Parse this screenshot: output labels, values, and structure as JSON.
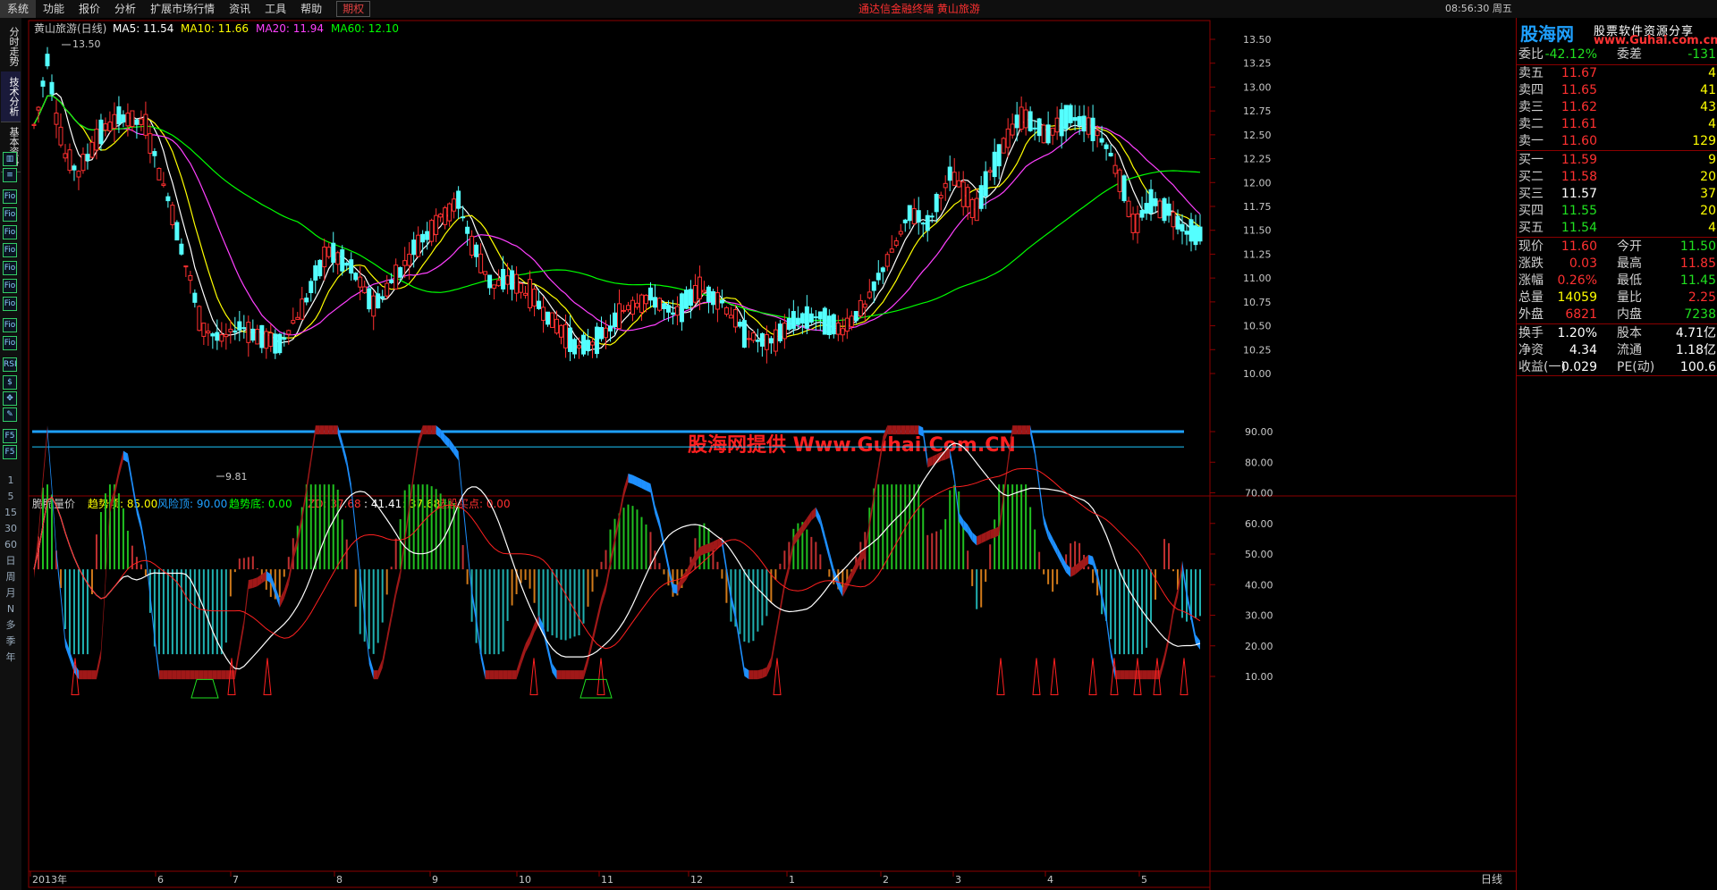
{
  "menu": {
    "items": [
      "系统",
      "功能",
      "报价",
      "分析",
      "扩展市场行情",
      "资讯",
      "工具",
      "帮助"
    ],
    "rights_tab": "期权",
    "center_title": "通达信金融终端    黄山旅游",
    "clock": "08:56:30 周五"
  },
  "left_tabs": [
    "分时走势",
    "技术分析",
    "基本资料"
  ],
  "left_tools": [
    "bar-chart",
    "list",
    "Fio",
    "Fio",
    "Fio",
    "Fio",
    "Fio",
    "Fio",
    "Fio",
    "Fio",
    "Fio",
    "RSI",
    "S",
    "move",
    "pencil",
    "F5",
    "F5"
  ],
  "left_periods": [
    "1",
    "5",
    "15",
    "30",
    "60",
    "日",
    "周",
    "月",
    "N",
    "多",
    "季",
    "年"
  ],
  "chart": {
    "header_title": "黄山旅游(日线)",
    "ma5": "MA5: 11.54",
    "ma10": "MA10: 11.66",
    "ma20": "MA20: 11.94",
    "ma60": "MA60: 12.10",
    "high_label": "13.50",
    "low_label": "9.81",
    "price_ticks": [
      "13.50",
      "13.25",
      "13.00",
      "12.75",
      "12.50",
      "12.25",
      "12.00",
      "11.75",
      "11.50",
      "11.25",
      "11.00",
      "10.75",
      "10.50",
      "10.25",
      "10.00"
    ],
    "watermark": "股海网提供 Www.Guhai.Com.CN",
    "indicator_name": "脆脆量价",
    "ind_trend_top": "趋势项: 85.00",
    "ind_risk_top": "风险顶: 90.00",
    "ind_trend_bottom": "趋势底: 0.00",
    "ind_zd": "ZD: 37.68",
    "ind_v2": ": 41.41",
    "ind_v3": ": 37.68",
    "ind_pick": "选股买点: 0.00",
    "ind_ticks": [
      "90.00",
      "80.00",
      "70.00",
      "60.00",
      "50.00",
      "40.00",
      "30.00",
      "20.00",
      "10.00"
    ],
    "date_labels": [
      "2013年",
      "6",
      "7",
      "8",
      "9",
      "10",
      "11",
      "12",
      "1",
      "2",
      "3",
      "4",
      "5"
    ],
    "period_label": "日线"
  },
  "colors": {
    "ma5": "#ffffff",
    "ma10": "#ffff00",
    "ma20": "#ff40ff",
    "ma60": "#00ff00",
    "up": "#ff3030",
    "down": "#54ffff",
    "axis": "#8b0000"
  },
  "quote": {
    "logo_main": "股海网",
    "logo_cn": "股票软件资源分享",
    "logo_url": "www.Guhai.com.cn",
    "weibi_label": "委比",
    "weibi": "-42.12%",
    "weicha_label": "委差",
    "weicha": "-131",
    "asks": [
      {
        "label": "卖五",
        "price": "11.67",
        "vol": "4"
      },
      {
        "label": "卖四",
        "price": "11.65",
        "vol": "41"
      },
      {
        "label": "卖三",
        "price": "11.62",
        "vol": "43"
      },
      {
        "label": "卖二",
        "price": "11.61",
        "vol": "4"
      },
      {
        "label": "卖一",
        "price": "11.60",
        "vol": "129"
      }
    ],
    "bids": [
      {
        "label": "买一",
        "price": "11.59",
        "vol": "9"
      },
      {
        "label": "买二",
        "price": "11.58",
        "vol": "20"
      },
      {
        "label": "买三",
        "price": "11.57",
        "vol": "37"
      },
      {
        "label": "买四",
        "price": "11.55",
        "vol": "20"
      },
      {
        "label": "买五",
        "price": "11.54",
        "vol": "4"
      }
    ],
    "stats1": [
      {
        "k1": "现价",
        "v1": "11.60",
        "k2": "今开",
        "v2": "11.50"
      },
      {
        "k1": "涨跌",
        "v1": "0.03",
        "k2": "最高",
        "v2": "11.85"
      },
      {
        "k1": "涨幅",
        "v1": "0.26%",
        "k2": "最低",
        "v2": "11.45"
      },
      {
        "k1": "总量",
        "v1": "14059",
        "k2": "量比",
        "v2": "2.25"
      },
      {
        "k1": "外盘",
        "v1": "6821",
        "k2": "内盘",
        "v2": "7238"
      }
    ],
    "stats2": [
      {
        "k1": "换手",
        "v1": "1.20%",
        "k2": "股本",
        "v2": "4.71亿"
      },
      {
        "k1": "净资",
        "v1": "4.34",
        "k2": "流通",
        "v2": "1.18亿"
      },
      {
        "k1": "收益(一)",
        "v1": "0.029",
        "k2": "PE(动)",
        "v2": "100.6"
      }
    ]
  }
}
